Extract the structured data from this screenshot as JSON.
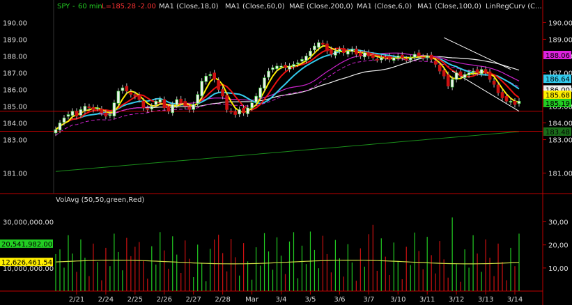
{
  "header": {
    "symbol": "SPY",
    "interval": "60 min",
    "last_label": "L=185.28",
    "change": "-2.00",
    "studies": [
      "MA1 (Close,18,0)",
      "MA1 (Close,60,0)",
      "MAE (Close,200,0)",
      "MA1 (Close,6,0)",
      "MA1 (Close,100,0)",
      "LinRegCurv (C..."
    ]
  },
  "volume_header": {
    "label": "VolAvg (50,50,green,Red)"
  },
  "colors": {
    "background": "#000000",
    "frame": "#c00000",
    "up_bar": "#22cc22",
    "down_bar": "#cc1111",
    "ma18": "#ee1111",
    "ma60": "#cc22cc",
    "mae200": "#cc22cc",
    "ma6": "#ffee00",
    "ma100": "#eeeeee",
    "linreg": "#33ccee",
    "long_ma": "#1a8c1a",
    "vol_avg": "#ccdd44"
  },
  "chart_data": [
    {
      "type": "candlestick",
      "title": "SPY - 60 min",
      "ylabel_ticks": [
        "190.00",
        "189.00",
        "188.00",
        "187.00",
        "186.00",
        "185.00",
        "184.00",
        "183.00",
        "181.00"
      ],
      "ylabel_ticks_left": [
        "190.00",
        "189.00",
        "188.00",
        "187.00",
        "186.00",
        "185.00",
        "184.00",
        "183.00",
        "181.00"
      ],
      "ylabel_ticks_right": [
        "190.00",
        "189.00",
        "188.00",
        "187.00",
        "186.00",
        "185.00",
        "184.00",
        "183.00",
        "181.00"
      ],
      "y_ticks": [
        190,
        189,
        188,
        187,
        186,
        185,
        184,
        183,
        181
      ],
      "ylim": [
        179.9,
        190.6
      ],
      "x_tick_labels": [
        "2/21",
        "2/24",
        "2/25",
        "2/26",
        "2/27",
        "2/28",
        "Mar",
        "3/4",
        "3/5",
        "3/6",
        "3/7",
        "3/10",
        "3/11",
        "3/12",
        "3/13",
        "3/14"
      ],
      "x_tick_index": [
        5,
        12,
        19,
        26,
        33,
        40,
        47,
        54,
        61,
        68,
        75,
        82,
        89,
        96,
        103,
        110
      ],
      "bar_count": 112,
      "closes": [
        183.6,
        184.0,
        184.3,
        184.5,
        184.7,
        184.4,
        184.8,
        185.0,
        184.9,
        184.8,
        184.9,
        184.6,
        184.4,
        184.5,
        185.2,
        185.9,
        186.1,
        185.9,
        185.7,
        185.6,
        185.4,
        184.9,
        184.8,
        185.0,
        185.3,
        185.4,
        184.9,
        184.7,
        185.1,
        185.4,
        185.2,
        185.0,
        184.8,
        185.1,
        185.7,
        186.5,
        186.8,
        186.9,
        186.6,
        186.0,
        185.6,
        184.8,
        184.7,
        184.5,
        184.8,
        184.6,
        184.9,
        185.2,
        185.6,
        186.1,
        186.7,
        187.1,
        187.3,
        187.4,
        187.4,
        187.3,
        187.4,
        187.5,
        187.6,
        187.8,
        188.0,
        188.3,
        188.6,
        188.8,
        188.7,
        188.3,
        188.1,
        188.3,
        188.4,
        188.2,
        188.3,
        188.4,
        188.1,
        188.0,
        188.2,
        188.0,
        187.9,
        187.8,
        187.9,
        187.9,
        187.8,
        187.9,
        188.0,
        187.9,
        187.8,
        187.9,
        188.1,
        188.0,
        187.9,
        188.0,
        187.8,
        187.5,
        187.1,
        186.8,
        186.2,
        186.6,
        187.0,
        186.8,
        186.9,
        187.0,
        187.1,
        187.0,
        187.2,
        187.0,
        186.6,
        186.3,
        185.8,
        185.5,
        185.3,
        185.3,
        185.1,
        185.3
      ],
      "closes_note": "",
      "support_lines": [
        184.7,
        183.5
      ],
      "price_boxes": [
        {
          "label": "188.06",
          "value": 188.06,
          "bg": "#dd22dd",
          "fg": "#000000"
        },
        {
          "label": "186.64",
          "value": 186.64,
          "bg": "#33ccee",
          "fg": "#000000"
        },
        {
          "label": "186.00",
          "value": 186.0,
          "bg": "#eeeeee",
          "fg": "#000000"
        },
        {
          "label": "185.68",
          "value": 185.68,
          "bg": "#ffee00",
          "fg": "#000000"
        },
        {
          "label": "185.19",
          "value": 185.19,
          "bg": "#22cc22",
          "fg": "#000000"
        },
        {
          "label": "183.48",
          "value": 183.48,
          "bg": "#1a6e1a",
          "fg": "#000000"
        }
      ]
    },
    {
      "type": "bar",
      "title": "VolAvg (50,50,green,Red)",
      "ylabel_ticks_left": [
        "30,000,000.00",
        "10,000,000.00"
      ],
      "ylabel_ticks_right": [
        "30,00",
        "20,00",
        "10,00"
      ],
      "y_ticks_left": [
        30000000,
        10000000
      ],
      "y_ticks_right": [
        30000000,
        20000000,
        10000000
      ],
      "ylim": [
        0,
        38000000
      ],
      "volume_boxes": [
        {
          "label": "20,541,982.00",
          "value": 20541982,
          "bg": "#22cc22",
          "fg": "#000000"
        },
        {
          "label": "12,626,461.54",
          "value": 12626461.54,
          "bg": "#ffee00",
          "fg": "#000000"
        }
      ]
    }
  ]
}
